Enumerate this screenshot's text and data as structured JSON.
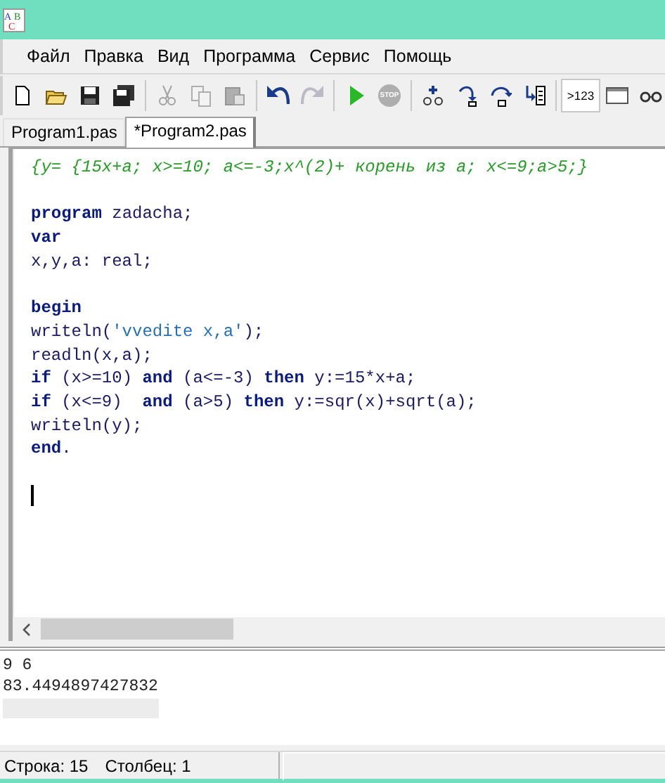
{
  "window": {
    "logo_letters": [
      "A",
      "B",
      "C"
    ]
  },
  "menu": [
    "Файл",
    "Правка",
    "Вид",
    "Программа",
    "Сервис",
    "Помощь"
  ],
  "toolbar": [
    {
      "kind": "new",
      "disabled": false
    },
    {
      "kind": "open",
      "disabled": false
    },
    {
      "kind": "save",
      "disabled": false
    },
    {
      "kind": "save-all",
      "disabled": false
    },
    {
      "kind": "separator"
    },
    {
      "kind": "cut",
      "disabled": true
    },
    {
      "kind": "copy",
      "disabled": true
    },
    {
      "kind": "paste",
      "disabled": true
    },
    {
      "kind": "separator"
    },
    {
      "kind": "undo",
      "disabled": false
    },
    {
      "kind": "redo",
      "disabled": true
    },
    {
      "kind": "separator"
    },
    {
      "kind": "run",
      "disabled": false
    },
    {
      "kind": "stop",
      "label": "STOP",
      "disabled": true
    },
    {
      "kind": "separator"
    },
    {
      "kind": "watch",
      "disabled": false
    },
    {
      "kind": "step-into",
      "disabled": false
    },
    {
      "kind": "step-over",
      "disabled": false
    },
    {
      "kind": "run-to-cursor",
      "disabled": false
    },
    {
      "kind": "separator"
    },
    {
      "kind": "text",
      "label": ">123",
      "pressed": true
    },
    {
      "kind": "window",
      "disabled": false
    },
    {
      "kind": "glasses",
      "disabled": false
    }
  ],
  "tabs": [
    {
      "label": "Program1.pas",
      "selected": false
    },
    {
      "label": "*Program2.pas",
      "selected": true
    }
  ],
  "editor": {
    "lines": [
      {
        "kind": "code",
        "segments": [
          {
            "kind": "comment",
            "text": "{y= {15x+a; x>=10; a<=-3;x^(2)+ корень из a; x<=9;a>5;}"
          }
        ]
      },
      {
        "kind": "blank"
      },
      {
        "kind": "code",
        "segments": [
          {
            "kind": "keyword",
            "text": "program"
          },
          {
            "kind": "plain",
            "text": " zadacha;"
          }
        ]
      },
      {
        "kind": "code",
        "segments": [
          {
            "kind": "keyword",
            "text": "var"
          }
        ]
      },
      {
        "kind": "code",
        "segments": [
          {
            "kind": "plain",
            "text": "x,y,a: real;"
          }
        ]
      },
      {
        "kind": "blank"
      },
      {
        "kind": "code",
        "segments": [
          {
            "kind": "keyword",
            "text": "begin"
          }
        ]
      },
      {
        "kind": "code",
        "segments": [
          {
            "kind": "plain",
            "text": "writeln("
          },
          {
            "kind": "string",
            "text": "'vvedite x,a'"
          },
          {
            "kind": "plain",
            "text": ");"
          }
        ]
      },
      {
        "kind": "code",
        "segments": [
          {
            "kind": "plain",
            "text": "readln(x,a);"
          }
        ]
      },
      {
        "kind": "code",
        "segments": [
          {
            "kind": "keyword",
            "text": "if"
          },
          {
            "kind": "plain",
            "text": " (x>=10) "
          },
          {
            "kind": "keyword",
            "text": "and"
          },
          {
            "kind": "plain",
            "text": " (a<=-3) "
          },
          {
            "kind": "keyword",
            "text": "then"
          },
          {
            "kind": "plain",
            "text": " y:=15*x+a;"
          }
        ]
      },
      {
        "kind": "code",
        "segments": [
          {
            "kind": "keyword",
            "text": "if"
          },
          {
            "kind": "plain",
            "text": " (x<=9)  "
          },
          {
            "kind": "keyword",
            "text": "and"
          },
          {
            "kind": "plain",
            "text": " (a>5) "
          },
          {
            "kind": "keyword",
            "text": "then"
          },
          {
            "kind": "plain",
            "text": " y:=sqr(x)+sqrt(a);"
          }
        ]
      },
      {
        "kind": "code",
        "segments": [
          {
            "kind": "plain",
            "text": "writeln(y);"
          }
        ]
      },
      {
        "kind": "code",
        "segments": [
          {
            "kind": "keyword",
            "text": "end"
          },
          {
            "kind": "plain",
            "text": "."
          }
        ]
      },
      {
        "kind": "blank"
      },
      {
        "kind": "caret"
      }
    ]
  },
  "output": [
    "9 6",
    "83.4494897427832"
  ],
  "status_bar": {
    "line": "Строка: 15",
    "column": "Столбец: 1"
  }
}
